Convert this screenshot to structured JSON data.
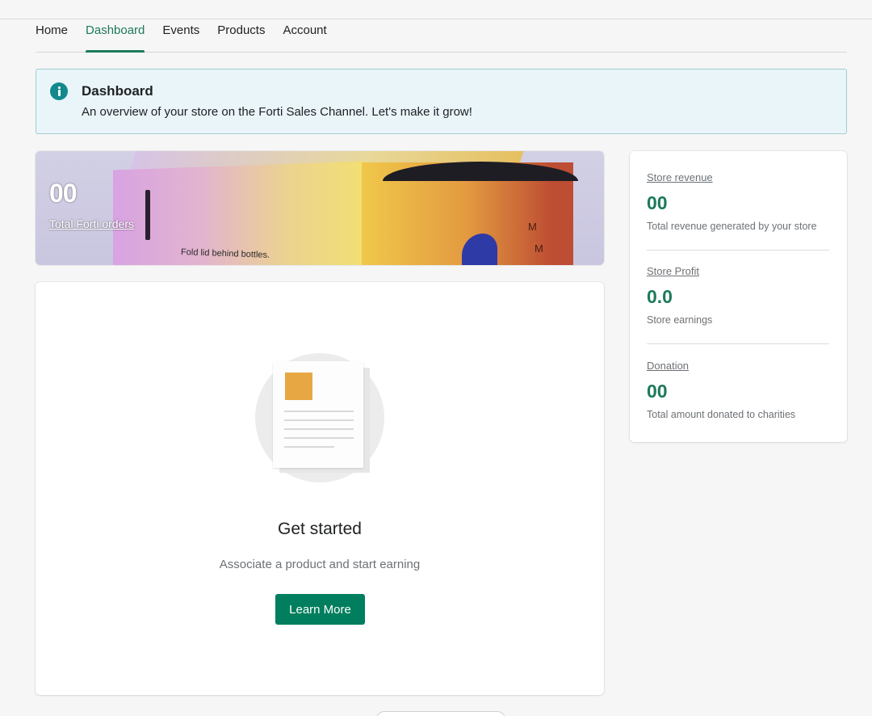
{
  "nav": {
    "tabs": [
      {
        "label": "Home"
      },
      {
        "label": "Dashboard",
        "active": true
      },
      {
        "label": "Events"
      },
      {
        "label": "Products"
      },
      {
        "label": "Account"
      }
    ]
  },
  "banner": {
    "icon": "info-icon",
    "title": "Dashboard",
    "text": "An overview of your store on the Forti Sales Channel. Let's make it grow!"
  },
  "hero": {
    "count": "00",
    "link_label": "Total Forti orders",
    "print_text": "Fold lid behind bottles.",
    "mark": "M"
  },
  "empty_state": {
    "title": "Get started",
    "subtitle": "Associate a product and start earning",
    "button_label": "Learn More"
  },
  "stats": {
    "revenue": {
      "label": "Store revenue",
      "value": "00",
      "desc": "Total revenue generated by your store"
    },
    "profit": {
      "label": "Store Profit",
      "value": "0.0",
      "desc": "Store earnings"
    },
    "donation": {
      "label": "Donation",
      "value": "00",
      "desc": "Total amount donated to charities"
    }
  },
  "colors": {
    "accent": "#1d7a5a",
    "button": "#007e5d",
    "info": "#12898c",
    "banner_bg": "#eaf5fa"
  }
}
